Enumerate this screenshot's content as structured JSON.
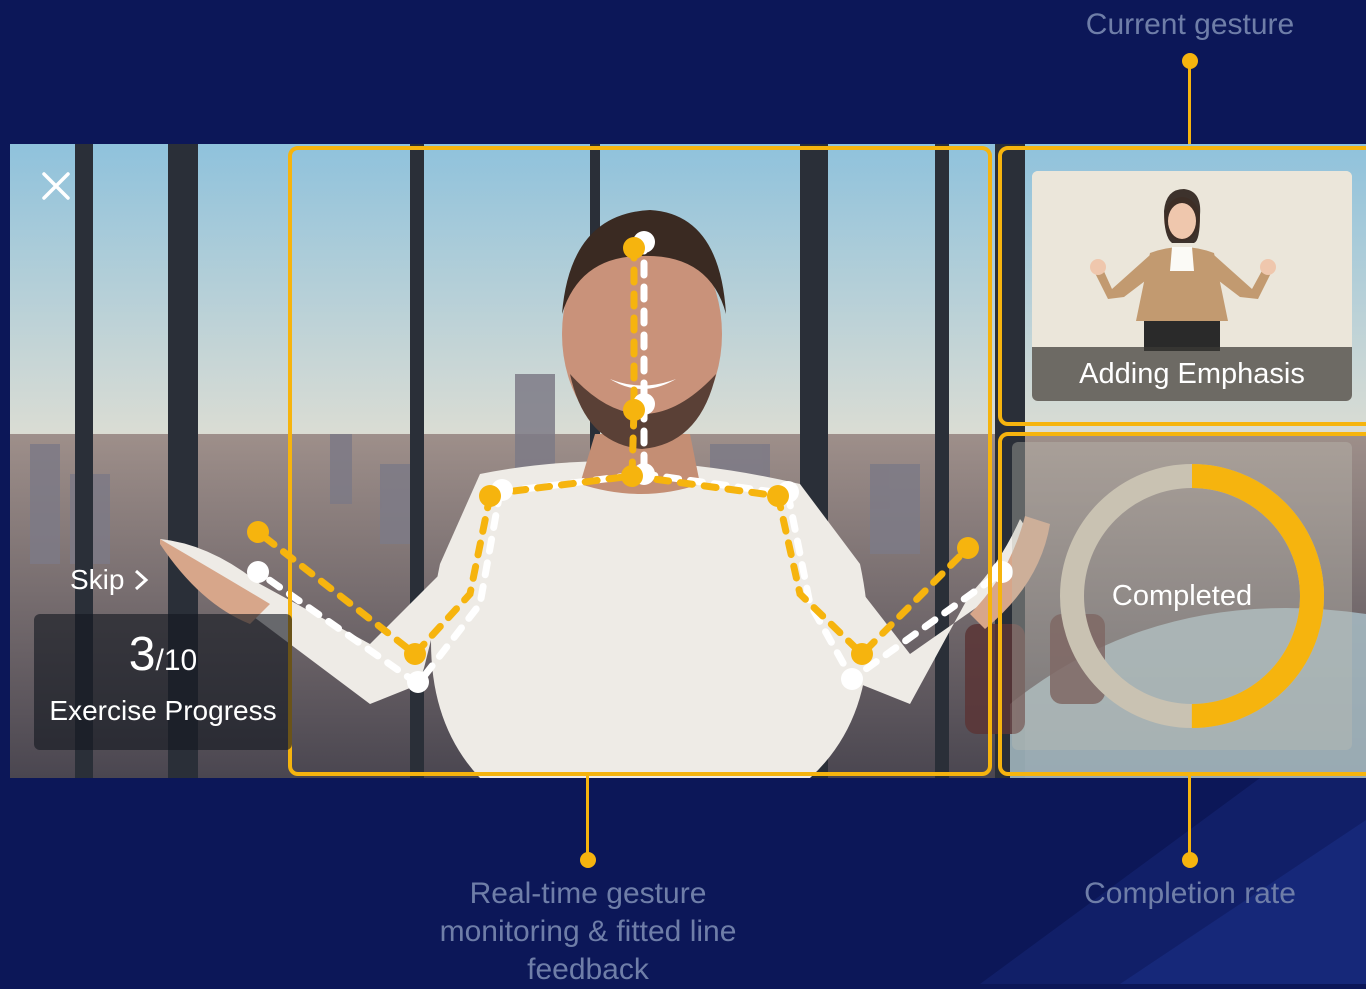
{
  "callouts": {
    "current_gesture": "Current gesture",
    "realtime": [
      "Real-time gesture",
      "monitoring & fitted line",
      "feedback"
    ],
    "completion_rate": "Completion rate"
  },
  "controls": {
    "close_icon": "close-icon",
    "skip_label": "Skip",
    "skip_icon": "chevron-right-icon"
  },
  "progress": {
    "current": "3",
    "total": "/10",
    "label": "Exercise Progress"
  },
  "reference": {
    "gesture_name": "Adding Emphasis"
  },
  "completion": {
    "label": "Completed",
    "fraction": 0.5
  },
  "colors": {
    "background": "#0c1758",
    "accent": "#f6b40e",
    "callout_text": "#6f7ea8",
    "ring_track": "#c9c2b2"
  }
}
